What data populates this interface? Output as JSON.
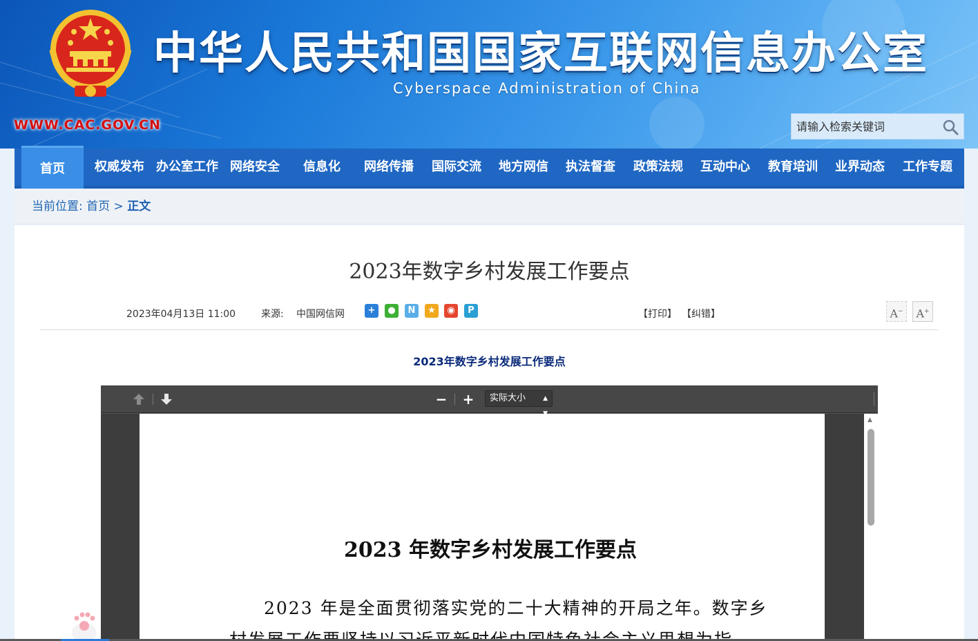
{
  "header": {
    "title_cn": "中华人民共和国国家互联网信息办公室",
    "title_en": "Cyberspace Administration of China",
    "url": "WWW.CAC.GOV.CN",
    "search_placeholder": "请输入检索关键词",
    "colors": {
      "url": "#d40f0f",
      "banner_start": "#0b55b8",
      "banner_end": "#7ec4f7"
    }
  },
  "nav": {
    "items": [
      {
        "label": "首页",
        "active": true
      },
      {
        "label": "权威发布"
      },
      {
        "label": "办公室工作"
      },
      {
        "label": "网络安全"
      },
      {
        "label": "信息化"
      },
      {
        "label": "网络传播"
      },
      {
        "label": "国际交流"
      },
      {
        "label": "地方网信"
      },
      {
        "label": "执法督查"
      },
      {
        "label": "政策法规"
      },
      {
        "label": "互动中心"
      },
      {
        "label": "教育培训"
      },
      {
        "label": "业界动态"
      },
      {
        "label": "工作专题"
      }
    ],
    "colors": {
      "bar": "#1f67c3",
      "active": "#3a8ee6"
    }
  },
  "breadcrumb": {
    "label": "当前位置:",
    "home": "首页",
    "separator": ">",
    "current": "正文"
  },
  "article": {
    "title": "2023年数字乡村发展工作要点",
    "date": "2023年04月13日 11:00",
    "source_label": "来源:",
    "source": "中国网信网",
    "share_icons": [
      "qzone-icon",
      "wechat-icon",
      "news-icon",
      "star-icon",
      "weibo-icon",
      "people-icon"
    ],
    "print": "【打印】",
    "correct": "【纠错】",
    "font_smaller": "A",
    "font_larger": "A",
    "subtitle": "2023年数字乡村发展工作要点"
  },
  "pdf_viewer": {
    "zoom": "实际大小",
    "zoom_out": "−",
    "zoom_in": "+",
    "page_title": "2023 年数字乡村发展工作要点",
    "para_line1": "2023 年是全面贯彻落实党的二十大精神的开局之年。数字乡",
    "para_line2": "村发展工作要坚持以习近平新时代中国特色社会主义思想为指"
  }
}
